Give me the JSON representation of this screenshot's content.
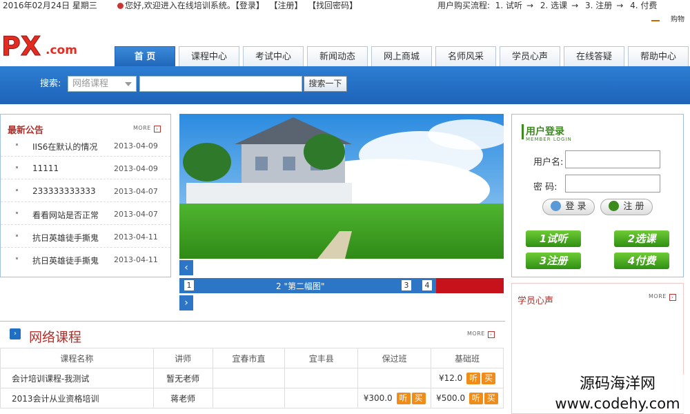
{
  "topbar": {
    "date": "2016年02月24日 星期三",
    "welcome": "您好,欢迎进入在线培训系统。",
    "login_link": "【登录】",
    "register_link": "【注册】",
    "recover_link": "【找回密码】",
    "flow_label": "用户购买流程:",
    "flow_steps": [
      "1. 试听",
      "2. 选课",
      "3. 注册",
      "4. 付费"
    ],
    "cart_label": "购物"
  },
  "logo": {
    "text": "PX",
    "suffix": ".com"
  },
  "nav": {
    "items": [
      "首 页",
      "课程中心",
      "考试中心",
      "新闻动态",
      "网上商城",
      "名师风采",
      "学员心声",
      "在线答疑",
      "帮助中心"
    ]
  },
  "search": {
    "label": "搜索:",
    "select_value": "网络课程",
    "input_value": "",
    "button": "搜索一下"
  },
  "notice": {
    "title": "最新公告",
    "more": "MORE",
    "items": [
      {
        "title": "IIS6在默认的情况",
        "date": "2013-04-09"
      },
      {
        "title": "11111",
        "date": "2013-04-09"
      },
      {
        "title": "233333333333",
        "date": "2013-04-07"
      },
      {
        "title": "看看网站是否正常",
        "date": "2013-04-07"
      },
      {
        "title": "抗日英雄徒手撕鬼",
        "date": "2013-04-11"
      },
      {
        "title": "抗日英雄徒手撕鬼",
        "date": "2013-04-11"
      }
    ]
  },
  "slider": {
    "prev": "‹",
    "next": "›",
    "numbers": [
      "1",
      "3",
      "4"
    ],
    "current": "2 \"第二幅图\""
  },
  "login": {
    "title": "用户登录",
    "subtitle": "MEMBER LOGIN",
    "username_label": "用户名:",
    "password_label": "密 码:",
    "login_button": "登 录",
    "register_button": "注 册",
    "steps": [
      "1试听",
      "2选课",
      "3注册",
      "4付费"
    ]
  },
  "voice": {
    "title": "学员心声",
    "more": "MORE"
  },
  "courses": {
    "title": "网络课程",
    "more": "MORE",
    "headers": [
      "课程名称",
      "讲师",
      "宜春市直",
      "宜丰县",
      "保过班",
      "基础班"
    ],
    "rows": [
      {
        "name": "会计培训课程-我测试",
        "teacher": "暂无老师",
        "c3": "",
        "c4": "",
        "c5_price": "",
        "c6_price": "¥12.0"
      },
      {
        "name": "2013会计从业资格培训",
        "teacher": "蒋老师",
        "c3": "",
        "c4": "",
        "c5_price": "¥300.0",
        "c6_price": "¥500.0"
      }
    ],
    "listen": "听",
    "buy": "买"
  },
  "watermark": {
    "line1": "源码海洋网",
    "line2": "www.codehy.com"
  },
  "colors": {
    "nav_blue": "#1e66b9",
    "red_title": "#b0302c",
    "green": "#3b8b1f",
    "orange": "#f08c1a"
  }
}
